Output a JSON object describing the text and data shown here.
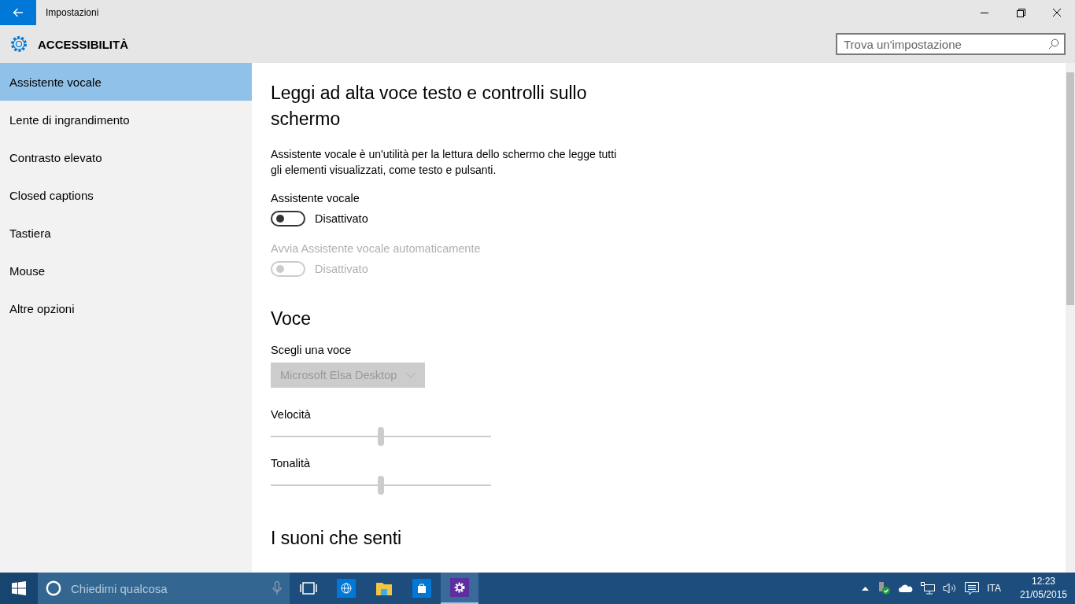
{
  "window": {
    "title": "Impostazioni"
  },
  "header": {
    "title": "ACCESSIBILITÀ"
  },
  "search": {
    "placeholder": "Trova un'impostazione"
  },
  "sidebar": {
    "items": [
      {
        "label": "Assistente vocale",
        "selected": true
      },
      {
        "label": "Lente di ingrandimento",
        "selected": false
      },
      {
        "label": "Contrasto elevato",
        "selected": false
      },
      {
        "label": "Closed captions",
        "selected": false
      },
      {
        "label": "Tastiera",
        "selected": false
      },
      {
        "label": "Mouse",
        "selected": false
      },
      {
        "label": "Altre opzioni",
        "selected": false
      }
    ]
  },
  "content": {
    "heading": "Leggi ad alta voce testo e controlli sullo schermo",
    "description": "Assistente vocale è un'utilità per la lettura dello schermo che legge tutti gli elementi visualizzati, come testo e pulsanti.",
    "toggles": [
      {
        "label": "Assistente vocale",
        "state_text": "Disattivato",
        "on": false,
        "disabled": false
      },
      {
        "label": "Avvia Assistente vocale automaticamente",
        "state_text": "Disattivato",
        "on": false,
        "disabled": true
      }
    ],
    "voice": {
      "heading": "Voce",
      "dropdown_label": "Scegli una voce",
      "dropdown_value": "Microsoft Elsa Desktop",
      "dropdown_disabled": true,
      "sliders": [
        {
          "label": "Velocità",
          "level": 0.5
        },
        {
          "label": "Tonalità",
          "level": 0.5
        }
      ]
    },
    "next_heading": "I suoni che senti"
  },
  "taskbar": {
    "search_placeholder": "Chiedimi qualcosa",
    "apps": [
      {
        "kind": "taskview",
        "selected": false
      },
      {
        "kind": "browser",
        "selected": false
      },
      {
        "kind": "folder",
        "selected": false
      },
      {
        "kind": "store",
        "selected": false
      },
      {
        "kind": "settings",
        "selected": true
      }
    ],
    "language": "ITA",
    "time": "12:23",
    "date": "21/05/2015"
  }
}
